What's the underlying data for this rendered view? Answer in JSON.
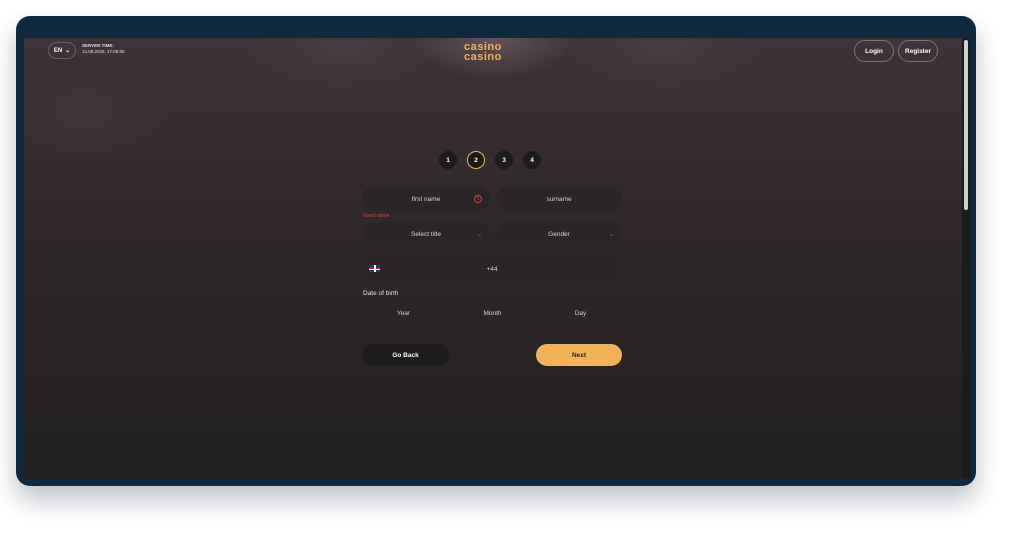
{
  "header": {
    "language": "EN",
    "server_time_label": "SERVER TIME:",
    "server_time_value": "14.08.2025, 17:05:56",
    "logo_line1": "casino",
    "logo_line2": "casino",
    "login_label": "Login",
    "register_label": "Register"
  },
  "steps": [
    "1",
    "2",
    "3",
    "4"
  ],
  "active_step": "2",
  "form": {
    "first_name_placeholder": "first name",
    "surname_placeholder": "surname",
    "first_name_error": "Insert name",
    "title_placeholder": "Select title",
    "gender_placeholder": "Gender",
    "phone_prefix": "+44",
    "dob_label": "Date of birth",
    "year_placeholder": "Year",
    "month_placeholder": "Month",
    "day_placeholder": "Day",
    "back_label": "Go Back",
    "next_label": "Next"
  },
  "colors": {
    "accent": "#f2b257",
    "error": "#d5453a",
    "frame": "#0f2a40"
  }
}
